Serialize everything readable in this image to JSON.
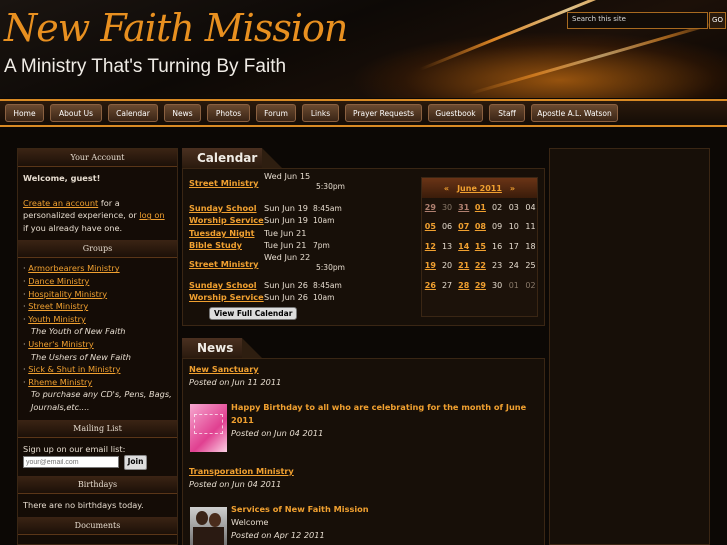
{
  "header": {
    "site_title": "New Faith Mission",
    "tagline": "A Ministry That's Turning By Faith",
    "search_placeholder": "Search this site",
    "search_button": "GO"
  },
  "nav": {
    "items": [
      "Home",
      "About Us",
      "Calendar",
      "News",
      "Photos",
      "Forum",
      "Links",
      "Prayer Requests",
      "Guestbook",
      "Staff",
      "Apostle A.L. Watson"
    ]
  },
  "sidebar": {
    "account": {
      "heading": "Your Account",
      "welcome": "Welcome, guest!",
      "create_link": "Create an account",
      "create_suffix": " for a personalized experience, or ",
      "login_link": "log on",
      "login_suffix": " if you already have one."
    },
    "groups": {
      "heading": "Groups",
      "items": [
        {
          "label": "Armorbearers Ministry"
        },
        {
          "label": "Dance Ministry"
        },
        {
          "label": "Hospitality Ministry"
        },
        {
          "label": "Street Ministry"
        },
        {
          "label": "Youth Ministry",
          "sub": "The Youth of New Faith"
        },
        {
          "label": "Usher's Ministry",
          "sub": "The Ushers of New Faith"
        },
        {
          "label": "Sick & Shut in Ministry"
        },
        {
          "label": "Rheme Ministry",
          "sub": "To purchase any CD's, Pens, Bags, Journals,etc...."
        }
      ]
    },
    "mailing": {
      "heading": "Mailing List",
      "text": "Sign up on our email list:",
      "placeholder": "your@email.com",
      "button": "Join"
    },
    "birthdays": {
      "heading": "Birthdays",
      "text": "There are no birthdays today."
    },
    "documents": {
      "heading": "Documents"
    }
  },
  "calendar": {
    "heading": "Calendar",
    "events": [
      {
        "name": "Street Ministry",
        "date": "Wed Jun 15",
        "time": "5:30pm"
      },
      {
        "name": "Sunday School",
        "date": "Sun Jun 19",
        "time": "8:45am"
      },
      {
        "name": "Worship Service",
        "date": "Sun Jun 19",
        "time": "10am"
      },
      {
        "name": "Tuesday Night",
        "date": "Tue Jun 21",
        "time": ""
      },
      {
        "name": "Bible Study",
        "date": "Tue Jun 21",
        "time": "7pm"
      },
      {
        "name": "Street Ministry",
        "date": "Wed Jun 22",
        "time": "5:30pm"
      },
      {
        "name": "Sunday School",
        "date": "Sun Jun 26",
        "time": "8:45am"
      },
      {
        "name": "Worship Service",
        "date": "Sun Jun 26",
        "time": "10am"
      }
    ],
    "full_calendar_button": "View Full Calendar",
    "mini": {
      "prev": "«",
      "month": "June 2011",
      "next": "»",
      "weeks": [
        [
          {
            "d": "29",
            "e": true,
            "o": true
          },
          {
            "d": "30",
            "e": false,
            "o": true
          },
          {
            "d": "31",
            "e": true,
            "o": true
          },
          {
            "d": "01",
            "e": true,
            "o": false
          },
          {
            "d": "02",
            "e": false,
            "o": false
          },
          {
            "d": "03",
            "e": false,
            "o": false
          },
          {
            "d": "04",
            "e": false,
            "o": false
          }
        ],
        [
          {
            "d": "05",
            "e": true,
            "o": false
          },
          {
            "d": "06",
            "e": false,
            "o": false
          },
          {
            "d": "07",
            "e": true,
            "o": false
          },
          {
            "d": "08",
            "e": true,
            "o": false
          },
          {
            "d": "09",
            "e": false,
            "o": false
          },
          {
            "d": "10",
            "e": false,
            "o": false
          },
          {
            "d": "11",
            "e": false,
            "o": false
          }
        ],
        [
          {
            "d": "12",
            "e": true,
            "o": false
          },
          {
            "d": "13",
            "e": false,
            "o": false
          },
          {
            "d": "14",
            "e": true,
            "o": false
          },
          {
            "d": "15",
            "e": true,
            "o": false
          },
          {
            "d": "16",
            "e": false,
            "o": false
          },
          {
            "d": "17",
            "e": false,
            "o": false
          },
          {
            "d": "18",
            "e": false,
            "o": false
          }
        ],
        [
          {
            "d": "19",
            "e": true,
            "o": false
          },
          {
            "d": "20",
            "e": false,
            "o": false
          },
          {
            "d": "21",
            "e": true,
            "o": false
          },
          {
            "d": "22",
            "e": true,
            "o": false
          },
          {
            "d": "23",
            "e": false,
            "o": false
          },
          {
            "d": "24",
            "e": false,
            "o": false
          },
          {
            "d": "25",
            "e": false,
            "o": false
          }
        ],
        [
          {
            "d": "26",
            "e": true,
            "o": false
          },
          {
            "d": "27",
            "e": false,
            "o": false
          },
          {
            "d": "28",
            "e": true,
            "o": false
          },
          {
            "d": "29",
            "e": true,
            "o": false
          },
          {
            "d": "30",
            "e": false,
            "o": false
          },
          {
            "d": "01",
            "e": false,
            "o": true
          },
          {
            "d": "02",
            "e": false,
            "o": true
          }
        ]
      ]
    }
  },
  "news": {
    "heading": "News",
    "items": [
      {
        "title": "New Sanctuary",
        "meta": "Posted on Jun 11 2011"
      },
      {
        "title": "Happy Birthday to all who are celebrating for the month of June 2011",
        "meta": "Posted on Jun 04 2011"
      },
      {
        "title": "Transporation Ministry",
        "meta": "Posted on Jun 04 2011"
      },
      {
        "title": "Services of New Faith Mission",
        "sub": "Welcome",
        "meta": "Posted on Apr 12 2011"
      }
    ]
  },
  "colors": {
    "accent": "#f0a030",
    "background": "#0c0805",
    "nav_border": "#d98a24"
  }
}
